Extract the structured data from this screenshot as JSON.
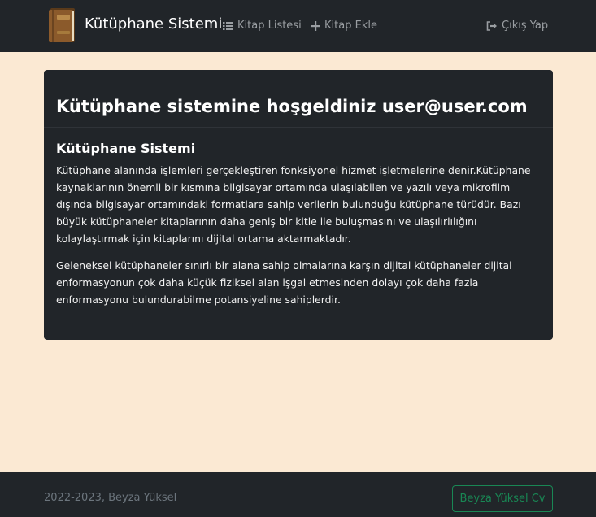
{
  "navbar": {
    "brand": "Kütüphane Sistemi",
    "brand_icon": "book-logo-icon",
    "links": [
      {
        "label": "Kitap Listesi",
        "icon": "list-icon"
      },
      {
        "label": "Kitap Ekle",
        "icon": "plus-icon"
      }
    ],
    "logout": {
      "label": "Çıkış Yap",
      "icon": "sign-out-icon"
    }
  },
  "main": {
    "welcome": "Kütüphane sistemine hoşgeldiniz user@user.com",
    "section_title": "Kütüphane Sistemi",
    "paragraphs": [
      "Kütüphane alanında işlemleri gerçekleştiren fonksiyonel hizmet işletmelerine denir.Kütüphane kaynaklarının önemli bir kısmına bilgisayar ortamında ulaşılabilen ve yazılı veya mikrofilm dışında bilgisayar ortamındaki formatlara sahip verilerin bulunduğu kütüphane türüdür. Bazı büyük kütüphaneler kitaplarının daha geniş bir kitle ile buluşmasını ve ulaşılırlılığını kolaylaştırmak için kitaplarını dijital ortama aktarmaktadır.",
      "Geleneksel kütüphaneler sınırlı bir alana sahip olmalarına karşın dijital kütüphaneler dijital enformasyonun çok daha küçük fiziksel alan işgal etmesinden dolayı çok daha fazla enformasyonu bulundurabilme potansiyeline sahiplerdir."
    ]
  },
  "footer": {
    "copyright": "2022-2023, Beyza Yüksel",
    "cv_button": "Beyza Yüksel Cv"
  },
  "colors": {
    "navbar_bg": "#212529",
    "page_bg": "#fbe9d3",
    "card_bg": "#212529",
    "success": "#198754",
    "muted": "#6c757d"
  }
}
